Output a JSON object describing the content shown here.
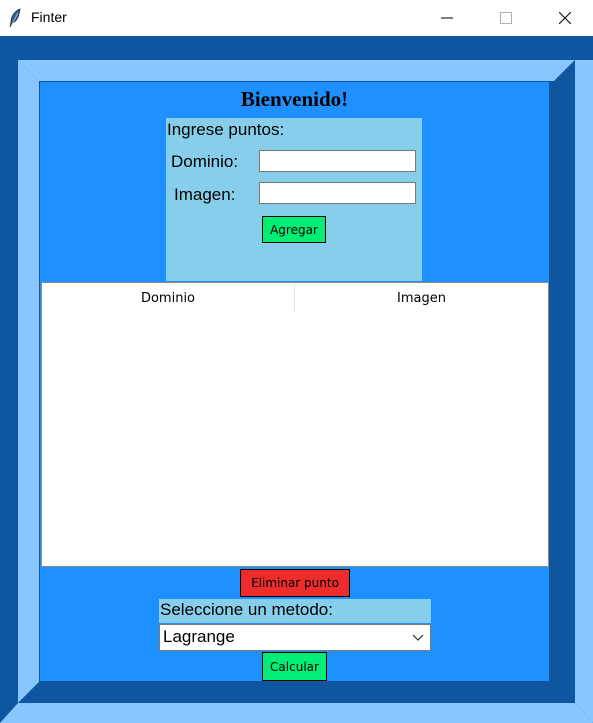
{
  "window": {
    "title": "Finter",
    "controls": [
      "minimize",
      "maximize",
      "close"
    ]
  },
  "header": {
    "welcome": "Bienvenido!"
  },
  "entry": {
    "heading": "Ingrese puntos:",
    "domain_label": "Dominio:",
    "domain_value": "",
    "image_label": "Imagen:",
    "image_value": "",
    "add_button": "Agregar"
  },
  "table": {
    "columns": [
      "Dominio",
      "Imagen"
    ],
    "rows": []
  },
  "actions": {
    "delete_button": "Eliminar punto",
    "method_label": "Seleccione un metodo:",
    "method_selected": "Lagrange",
    "calculate_button": "Calcular"
  },
  "colors": {
    "frame_dark": "#0e56a0",
    "frame_light": "#87c6ff",
    "panel": "#1e90ff",
    "entry_panel": "#87ceeb",
    "button_green": "#00ee76",
    "button_red": "#ee2c2c"
  },
  "icons": [
    "feather-icon",
    "minimize-icon",
    "maximize-icon",
    "close-icon",
    "chevron-down-icon"
  ]
}
